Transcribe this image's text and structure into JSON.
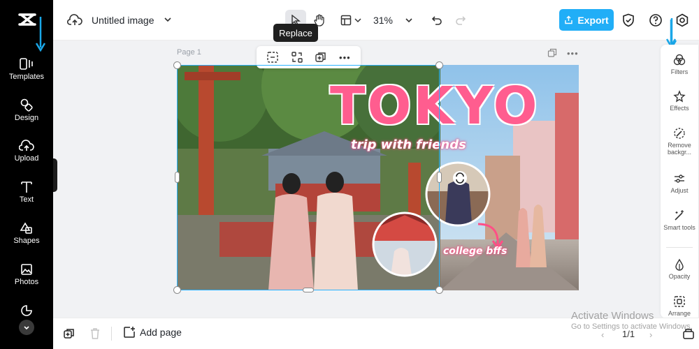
{
  "sidebar": {
    "items": [
      {
        "label": "Templates",
        "icon": "templates-icon"
      },
      {
        "label": "Design",
        "icon": "design-icon"
      },
      {
        "label": "Upload",
        "icon": "upload-icon"
      },
      {
        "label": "Text",
        "icon": "text-icon"
      },
      {
        "label": "Shapes",
        "icon": "shapes-icon"
      },
      {
        "label": "Photos",
        "icon": "photos-icon"
      }
    ]
  },
  "topbar": {
    "title": "Untitled image",
    "zoom": "31%",
    "export_label": "Export"
  },
  "tooltip": "Replace",
  "canvas": {
    "page_label": "Page 1",
    "poster": {
      "headline": "TOKYO",
      "subtitle": "trip with friends",
      "caption": "college bffs"
    }
  },
  "right_panel": {
    "items": [
      {
        "label": "Filters",
        "icon": "filters-icon"
      },
      {
        "label": "Effects",
        "icon": "effects-icon"
      },
      {
        "label": "Remove backgr...",
        "icon": "remove-background-icon"
      },
      {
        "label": "Adjust",
        "icon": "adjust-icon"
      },
      {
        "label": "Smart tools",
        "icon": "smart-tools-icon"
      },
      {
        "label": "Opacity",
        "icon": "opacity-icon"
      },
      {
        "label": "Arrange",
        "icon": "arrange-icon"
      }
    ]
  },
  "bottombar": {
    "add_page_label": "Add page",
    "page_indicator": "1/1"
  },
  "watermark": {
    "line1": "Activate Windows",
    "line2": "Go to Settings to activate Windows."
  },
  "colors": {
    "accent": "#21aef7",
    "sidebar_bg": "#000000",
    "selection": "#2bb3ff",
    "headline": "#ff5d8f"
  }
}
